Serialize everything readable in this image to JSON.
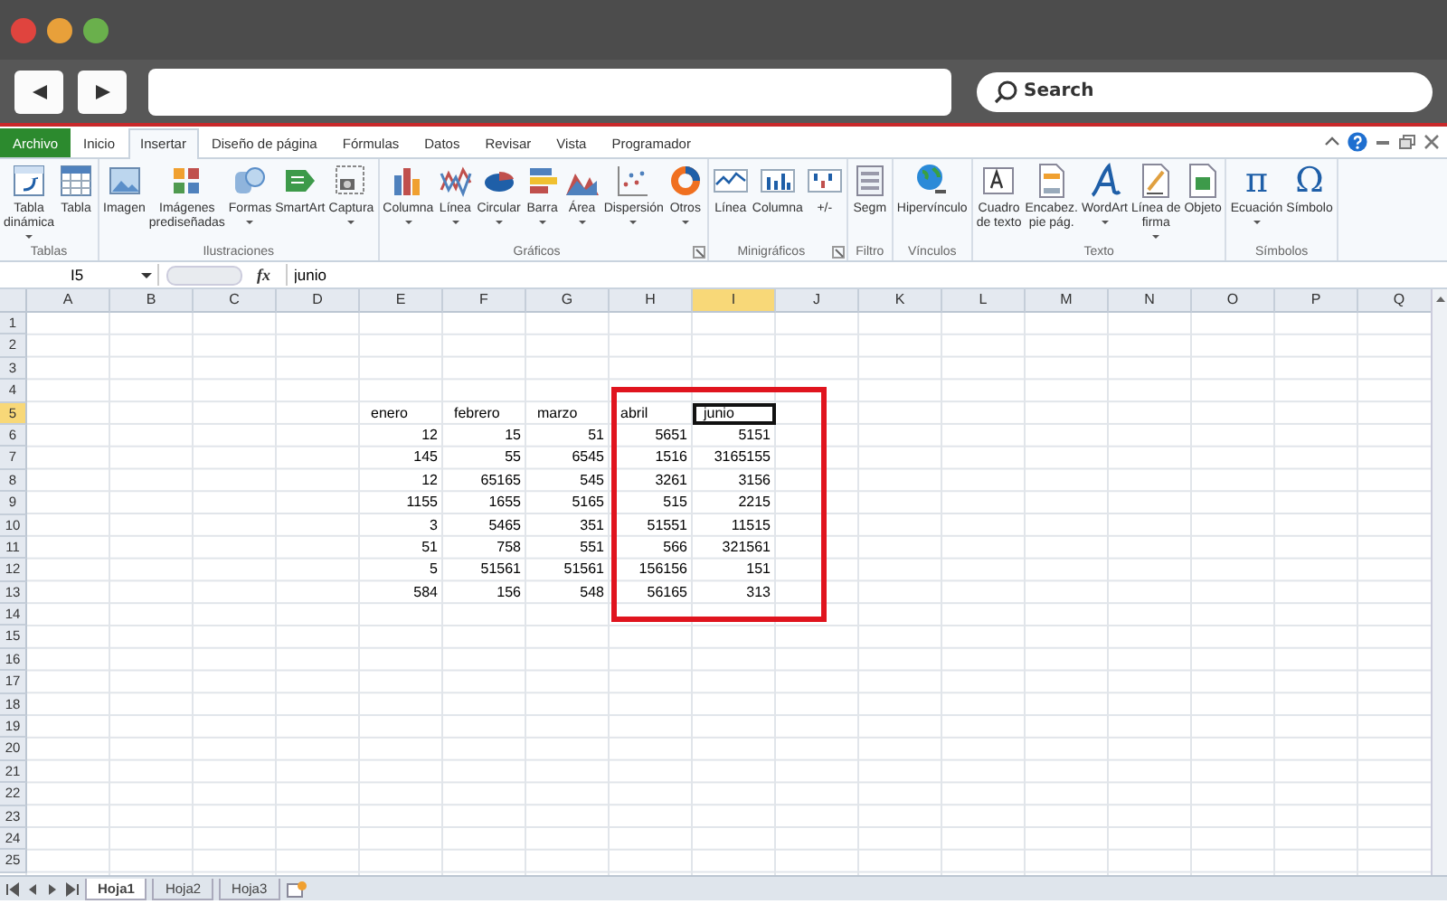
{
  "browser": {
    "search_placeholder": "Search"
  },
  "ribbon": {
    "tabs": [
      {
        "label": "Archivo",
        "kind": "file",
        "selected": false
      },
      {
        "label": "Inicio",
        "kind": "tab",
        "selected": false
      },
      {
        "label": "Insertar",
        "kind": "tab",
        "selected": true
      },
      {
        "label": "Diseño de página",
        "kind": "tab",
        "selected": false
      },
      {
        "label": "Fórmulas",
        "kind": "tab",
        "selected": false
      },
      {
        "label": "Datos",
        "kind": "tab",
        "selected": false
      },
      {
        "label": "Revisar",
        "kind": "tab",
        "selected": false
      },
      {
        "label": "Vista",
        "kind": "tab",
        "selected": false
      },
      {
        "label": "Programador",
        "kind": "tab",
        "selected": false
      }
    ],
    "groups": [
      {
        "label": "Tablas",
        "launcher": false,
        "items": [
          {
            "label": "Tabla\ndinámica",
            "dropdown": true
          },
          {
            "label": "Tabla",
            "dropdown": false
          }
        ]
      },
      {
        "label": "Ilustraciones",
        "launcher": false,
        "items": [
          {
            "label": "Imagen",
            "dropdown": false
          },
          {
            "label": "Imágenes\nprediseñadas",
            "dropdown": false
          },
          {
            "label": "Formas",
            "dropdown": true
          },
          {
            "label": "SmartArt",
            "dropdown": false
          },
          {
            "label": "Captura",
            "dropdown": true
          }
        ]
      },
      {
        "label": "Gráficos",
        "launcher": true,
        "items": [
          {
            "label": "Columna",
            "dropdown": true
          },
          {
            "label": "Línea",
            "dropdown": true
          },
          {
            "label": "Circular",
            "dropdown": true
          },
          {
            "label": "Barra",
            "dropdown": true
          },
          {
            "label": "Área",
            "dropdown": true
          },
          {
            "label": "Dispersión",
            "dropdown": true
          },
          {
            "label": "Otros",
            "dropdown": true
          }
        ]
      },
      {
        "label": "Minigráficos",
        "launcher": true,
        "items": [
          {
            "label": "Línea",
            "dropdown": false
          },
          {
            "label": "Columna",
            "dropdown": false
          },
          {
            "label": "+/-",
            "dropdown": false
          }
        ]
      },
      {
        "label": "Filtro",
        "launcher": false,
        "items": [
          {
            "label": "Segm",
            "dropdown": false
          }
        ]
      },
      {
        "label": "Vínculos",
        "launcher": false,
        "items": [
          {
            "label": "Hipervínculo",
            "dropdown": false
          }
        ]
      },
      {
        "label": "Texto",
        "launcher": false,
        "items": [
          {
            "label": "Cuadro\nde texto",
            "dropdown": false
          },
          {
            "label": "Encabez.\npie pág.",
            "dropdown": false
          },
          {
            "label": "WordArt",
            "dropdown": true
          },
          {
            "label": "Línea de\nfirma",
            "dropdown": true
          },
          {
            "label": "Objeto",
            "dropdown": false
          }
        ]
      },
      {
        "label": "Símbolos",
        "launcher": false,
        "items": [
          {
            "label": "Ecuación",
            "dropdown": true,
            "glyph": "π"
          },
          {
            "label": "Símbolo",
            "dropdown": false,
            "glyph": "Ω"
          }
        ]
      }
    ]
  },
  "formula_bar": {
    "name_box": "I5",
    "function_button": "fx",
    "value": "junio"
  },
  "sheet": {
    "columns": [
      {
        "label": "A",
        "selected": false
      },
      {
        "label": "B",
        "selected": false
      },
      {
        "label": "C",
        "selected": false
      },
      {
        "label": "D",
        "selected": false
      },
      {
        "label": "E",
        "selected": false
      },
      {
        "label": "F",
        "selected": false
      },
      {
        "label": "G",
        "selected": false
      },
      {
        "label": "H",
        "selected": false
      },
      {
        "label": "I",
        "selected": true
      },
      {
        "label": "J",
        "selected": false
      },
      {
        "label": "K",
        "selected": false
      },
      {
        "label": "L",
        "selected": false
      },
      {
        "label": "M",
        "selected": false
      },
      {
        "label": "N",
        "selected": false
      },
      {
        "label": "O",
        "selected": false
      },
      {
        "label": "P",
        "selected": false
      },
      {
        "label": "Q",
        "selected": false
      }
    ],
    "row_numbers": [
      {
        "label": "1",
        "selected": false
      },
      {
        "label": "2",
        "selected": false
      },
      {
        "label": "3",
        "selected": false
      },
      {
        "label": "4",
        "selected": false
      },
      {
        "label": "5",
        "selected": true
      },
      {
        "label": "6",
        "selected": false
      },
      {
        "label": "7",
        "selected": false
      },
      {
        "label": "8",
        "selected": false
      },
      {
        "label": "9",
        "selected": false
      },
      {
        "label": "10",
        "selected": false
      },
      {
        "label": "11",
        "selected": false
      },
      {
        "label": "12",
        "selected": false
      },
      {
        "label": "13",
        "selected": false
      },
      {
        "label": "14",
        "selected": false
      },
      {
        "label": "15",
        "selected": false
      },
      {
        "label": "16",
        "selected": false
      },
      {
        "label": "17",
        "selected": false
      },
      {
        "label": "18",
        "selected": false
      },
      {
        "label": "19",
        "selected": false
      },
      {
        "label": "20",
        "selected": false
      },
      {
        "label": "21",
        "selected": false
      },
      {
        "label": "22",
        "selected": false
      },
      {
        "label": "23",
        "selected": false
      },
      {
        "label": "24",
        "selected": false
      },
      {
        "label": "25",
        "selected": false
      }
    ],
    "table": {
      "headers": [
        {
          "text": "enero",
          "selected": false
        },
        {
          "text": "febrero",
          "selected": false
        },
        {
          "text": "marzo",
          "selected": false
        },
        {
          "text": "abril",
          "selected": false
        },
        {
          "text": "junio",
          "selected": true
        }
      ],
      "rows": [
        [
          "12",
          "15",
          "51",
          "5651",
          "5151"
        ],
        [
          "145",
          "55",
          "6545",
          "1516",
          "3165155"
        ],
        [
          "12",
          "65165",
          "545",
          "3261",
          "3156"
        ],
        [
          "1155",
          "1655",
          "5165",
          "515",
          "2215"
        ],
        [
          "3",
          "5465",
          "351",
          "51551",
          "11515"
        ],
        [
          "51",
          "758",
          "551",
          "566",
          "321561"
        ],
        [
          "5",
          "51561",
          "51561",
          "156156",
          "151"
        ],
        [
          "584",
          "156",
          "548",
          "56165",
          "313"
        ]
      ]
    }
  },
  "sheet_tabs": [
    {
      "label": "Hoja1",
      "selected": true
    },
    {
      "label": "Hoja2",
      "selected": false
    },
    {
      "label": "Hoja3",
      "selected": false
    }
  ]
}
